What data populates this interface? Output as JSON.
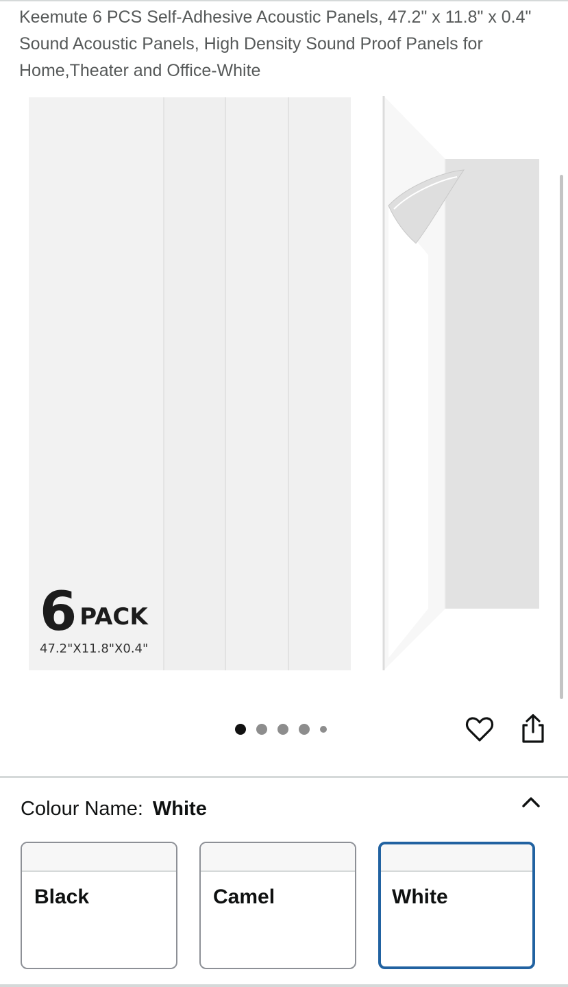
{
  "product": {
    "title": "Keemute 6 PCS Self-Adhesive Acoustic Panels, 47.2\" x 11.8\" x 0.4\" Sound Acoustic Panels, High Density Sound Proof Panels for Home,Theater and Office-White"
  },
  "image": {
    "badge_number": "6",
    "badge_word": "PACK",
    "badge_dimensions": "47.2\"X11.8\"X0.4\"",
    "dots_total": 5,
    "dots_active_index": 0
  },
  "actions": {
    "wishlist_icon": "heart-icon",
    "share_icon": "share-icon"
  },
  "variation": {
    "label": "Colour Name:",
    "selected": "White",
    "toggle_icon": "chevron-up-icon",
    "options": [
      {
        "name": "Black"
      },
      {
        "name": "Camel"
      },
      {
        "name": "White"
      }
    ]
  },
  "colors": {
    "selected_border": "#2162a1",
    "title_text": "#565959"
  }
}
